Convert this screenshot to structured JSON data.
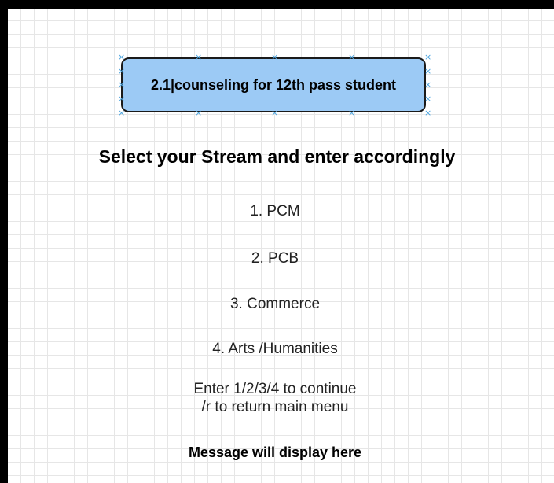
{
  "title_box": {
    "text": "2.1|counseling for 12th pass student",
    "fill_color": "#9ccaf5"
  },
  "heading": "Select your Stream and enter accordingly",
  "options": [
    {
      "label": "1. PCM"
    },
    {
      "label": "2. PCB"
    },
    {
      "label": "3. Commerce"
    },
    {
      "label": "4. Arts /Humanities"
    }
  ],
  "instructions": {
    "line1": "Enter 1/2/3/4 to continue",
    "line2": "/r to return main menu"
  },
  "message": "Message will display here"
}
